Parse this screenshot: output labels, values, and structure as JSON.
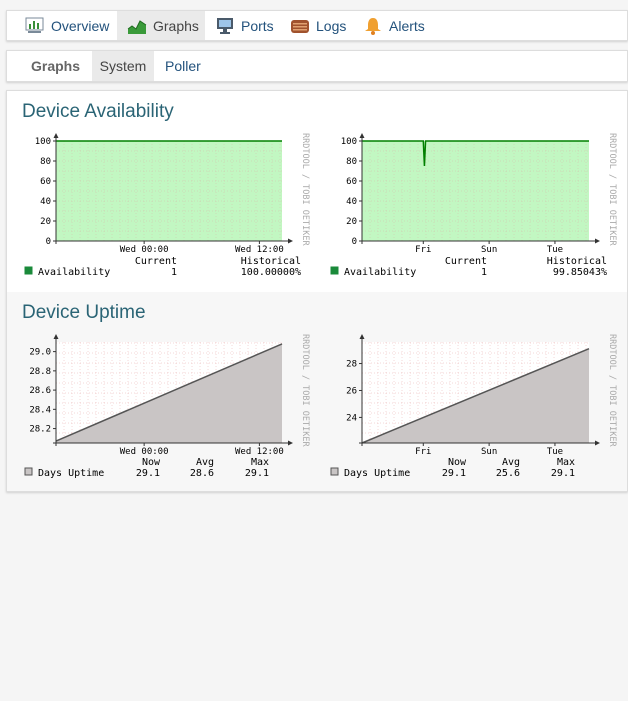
{
  "nav": {
    "tabs": [
      {
        "label": "Overview",
        "icon": "overview-chart-icon"
      },
      {
        "label": "Graphs",
        "icon": "graphs-icon",
        "active": true
      },
      {
        "label": "Ports",
        "icon": "ports-monitor-icon"
      },
      {
        "label": "Logs",
        "icon": "logs-icon"
      },
      {
        "label": "Alerts",
        "icon": "alerts-bell-icon"
      }
    ]
  },
  "subnav": {
    "label": "Graphs",
    "items": [
      {
        "label": "System",
        "active": true
      },
      {
        "label": "Poller"
      }
    ]
  },
  "sections": [
    {
      "title": "Device Availability"
    },
    {
      "title": "Device Uptime"
    }
  ],
  "watermark": "RRDTOOL / TOBI OETIKER",
  "colors": {
    "link": "#23527c",
    "title": "#2a6475",
    "availability_fill": "#cfffcf",
    "availability_line": "#008000",
    "uptime_fill": "#c9c5c5",
    "uptime_line": "#555555",
    "grid": "#e8b0b0"
  },
  "chart_data": [
    {
      "type": "area",
      "ylim": [
        0,
        100
      ],
      "yticks": [
        "0",
        "20",
        "40",
        "60",
        "80",
        "100"
      ],
      "xticks": [
        "Wed 00:00",
        "Wed 12:00"
      ],
      "x": [
        0,
        1
      ],
      "series": [
        {
          "name": "Availability",
          "values": [
            100,
            100
          ]
        }
      ],
      "legend": {
        "headers": [
          "Current",
          "Historical"
        ],
        "name": "Availability",
        "values": [
          "1",
          "100.00000%"
        ]
      }
    },
    {
      "type": "area",
      "ylim": [
        0,
        100
      ],
      "yticks": [
        "0",
        "20",
        "40",
        "60",
        "80",
        "100"
      ],
      "xticks": [
        "Fri",
        "Sun",
        "Tue"
      ],
      "x": [
        0,
        0.27,
        0.275,
        0.28,
        1
      ],
      "series": [
        {
          "name": "Availability",
          "values": [
            100,
            100,
            75,
            100,
            100
          ]
        }
      ],
      "legend": {
        "headers": [
          "Current",
          "Historical"
        ],
        "name": "Availability",
        "values": [
          "1",
          "99.85043%"
        ]
      }
    },
    {
      "type": "area",
      "ylim": [
        28.05,
        29.1
      ],
      "yticks": [
        "28.2",
        "28.4",
        "28.6",
        "28.8",
        "29.0"
      ],
      "xticks": [
        "Wed 00:00",
        "Wed 12:00"
      ],
      "x": [
        0,
        1
      ],
      "series": [
        {
          "name": "Days Uptime",
          "values": [
            28.07,
            29.08
          ]
        }
      ],
      "legend": {
        "headers": [
          "Now",
          "Avg",
          "Max"
        ],
        "name": "Days Uptime",
        "values": [
          "29.1",
          "28.6",
          "29.1"
        ]
      }
    },
    {
      "type": "area",
      "ylim": [
        22.1,
        29.6
      ],
      "yticks": [
        "24",
        "26",
        "28"
      ],
      "xticks": [
        "Fri",
        "Sun",
        "Tue"
      ],
      "x": [
        0,
        1
      ],
      "series": [
        {
          "name": "Days Uptime",
          "values": [
            22.1,
            29.1
          ]
        }
      ],
      "legend": {
        "headers": [
          "Now",
          "Avg",
          "Max"
        ],
        "name": "Days Uptime",
        "values": [
          "29.1",
          "25.6",
          "29.1"
        ]
      }
    }
  ]
}
